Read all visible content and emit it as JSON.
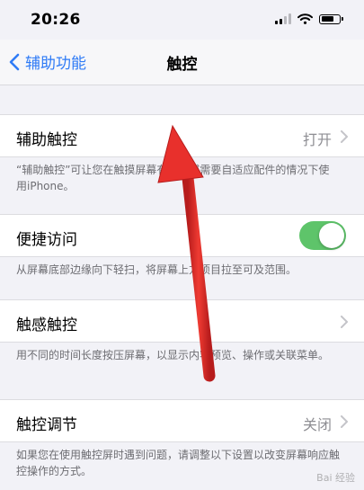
{
  "status": {
    "time": "20:26"
  },
  "nav": {
    "back_label": "辅助功能",
    "title": "触控"
  },
  "rows": [
    {
      "label": "辅助触控",
      "value": "打开",
      "footer": "“辅助触控”可让您在触摸屏幕有困难或需要自适应配件的情况下使用iPhone。"
    },
    {
      "label": "便捷访问",
      "toggle_on": true,
      "footer": "从屏幕底部边缘向下轻扫，将屏幕上方项目拉至可及范围。"
    },
    {
      "label": "触感触控",
      "footer": "用不同的时间长度按压屏幕，以显示内容预览、操作或关联菜单。"
    },
    {
      "label": "触控调节",
      "value": "关闭",
      "footer": "如果您在使用触控屏时遇到问题，请调整以下设置以改变屏幕响应触控操作的方式。"
    }
  ],
  "colors": {
    "accent": "#2f7bf6",
    "toggle_on": "#5ec46a",
    "annotation_arrow": "#e8302c"
  },
  "watermark": "Bai 经验"
}
